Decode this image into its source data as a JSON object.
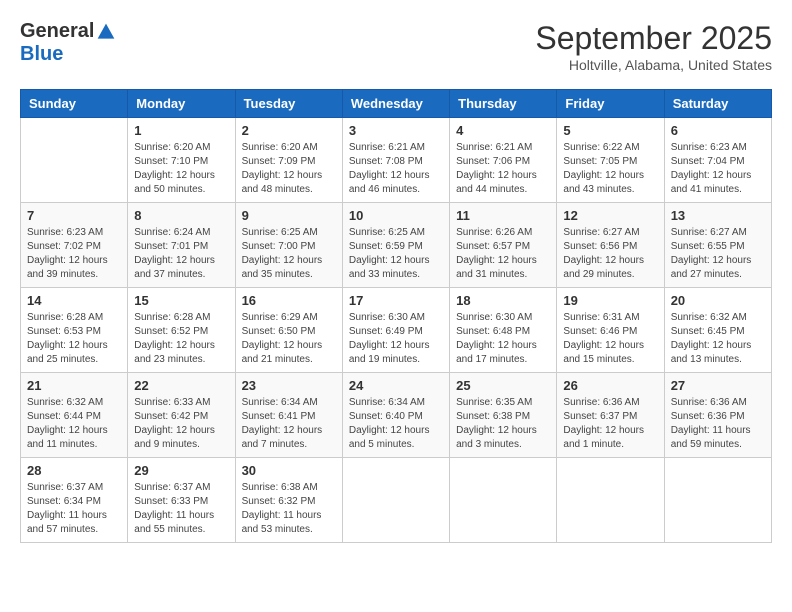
{
  "header": {
    "logo_general": "General",
    "logo_blue": "Blue",
    "month_title": "September 2025",
    "location": "Holtville, Alabama, United States"
  },
  "weekdays": [
    "Sunday",
    "Monday",
    "Tuesday",
    "Wednesday",
    "Thursday",
    "Friday",
    "Saturday"
  ],
  "weeks": [
    [
      {
        "day": "",
        "info": ""
      },
      {
        "day": "1",
        "info": "Sunrise: 6:20 AM\nSunset: 7:10 PM\nDaylight: 12 hours\nand 50 minutes."
      },
      {
        "day": "2",
        "info": "Sunrise: 6:20 AM\nSunset: 7:09 PM\nDaylight: 12 hours\nand 48 minutes."
      },
      {
        "day": "3",
        "info": "Sunrise: 6:21 AM\nSunset: 7:08 PM\nDaylight: 12 hours\nand 46 minutes."
      },
      {
        "day": "4",
        "info": "Sunrise: 6:21 AM\nSunset: 7:06 PM\nDaylight: 12 hours\nand 44 minutes."
      },
      {
        "day": "5",
        "info": "Sunrise: 6:22 AM\nSunset: 7:05 PM\nDaylight: 12 hours\nand 43 minutes."
      },
      {
        "day": "6",
        "info": "Sunrise: 6:23 AM\nSunset: 7:04 PM\nDaylight: 12 hours\nand 41 minutes."
      }
    ],
    [
      {
        "day": "7",
        "info": "Sunrise: 6:23 AM\nSunset: 7:02 PM\nDaylight: 12 hours\nand 39 minutes."
      },
      {
        "day": "8",
        "info": "Sunrise: 6:24 AM\nSunset: 7:01 PM\nDaylight: 12 hours\nand 37 minutes."
      },
      {
        "day": "9",
        "info": "Sunrise: 6:25 AM\nSunset: 7:00 PM\nDaylight: 12 hours\nand 35 minutes."
      },
      {
        "day": "10",
        "info": "Sunrise: 6:25 AM\nSunset: 6:59 PM\nDaylight: 12 hours\nand 33 minutes."
      },
      {
        "day": "11",
        "info": "Sunrise: 6:26 AM\nSunset: 6:57 PM\nDaylight: 12 hours\nand 31 minutes."
      },
      {
        "day": "12",
        "info": "Sunrise: 6:27 AM\nSunset: 6:56 PM\nDaylight: 12 hours\nand 29 minutes."
      },
      {
        "day": "13",
        "info": "Sunrise: 6:27 AM\nSunset: 6:55 PM\nDaylight: 12 hours\nand 27 minutes."
      }
    ],
    [
      {
        "day": "14",
        "info": "Sunrise: 6:28 AM\nSunset: 6:53 PM\nDaylight: 12 hours\nand 25 minutes."
      },
      {
        "day": "15",
        "info": "Sunrise: 6:28 AM\nSunset: 6:52 PM\nDaylight: 12 hours\nand 23 minutes."
      },
      {
        "day": "16",
        "info": "Sunrise: 6:29 AM\nSunset: 6:50 PM\nDaylight: 12 hours\nand 21 minutes."
      },
      {
        "day": "17",
        "info": "Sunrise: 6:30 AM\nSunset: 6:49 PM\nDaylight: 12 hours\nand 19 minutes."
      },
      {
        "day": "18",
        "info": "Sunrise: 6:30 AM\nSunset: 6:48 PM\nDaylight: 12 hours\nand 17 minutes."
      },
      {
        "day": "19",
        "info": "Sunrise: 6:31 AM\nSunset: 6:46 PM\nDaylight: 12 hours\nand 15 minutes."
      },
      {
        "day": "20",
        "info": "Sunrise: 6:32 AM\nSunset: 6:45 PM\nDaylight: 12 hours\nand 13 minutes."
      }
    ],
    [
      {
        "day": "21",
        "info": "Sunrise: 6:32 AM\nSunset: 6:44 PM\nDaylight: 12 hours\nand 11 minutes."
      },
      {
        "day": "22",
        "info": "Sunrise: 6:33 AM\nSunset: 6:42 PM\nDaylight: 12 hours\nand 9 minutes."
      },
      {
        "day": "23",
        "info": "Sunrise: 6:34 AM\nSunset: 6:41 PM\nDaylight: 12 hours\nand 7 minutes."
      },
      {
        "day": "24",
        "info": "Sunrise: 6:34 AM\nSunset: 6:40 PM\nDaylight: 12 hours\nand 5 minutes."
      },
      {
        "day": "25",
        "info": "Sunrise: 6:35 AM\nSunset: 6:38 PM\nDaylight: 12 hours\nand 3 minutes."
      },
      {
        "day": "26",
        "info": "Sunrise: 6:36 AM\nSunset: 6:37 PM\nDaylight: 12 hours\nand 1 minute."
      },
      {
        "day": "27",
        "info": "Sunrise: 6:36 AM\nSunset: 6:36 PM\nDaylight: 11 hours\nand 59 minutes."
      }
    ],
    [
      {
        "day": "28",
        "info": "Sunrise: 6:37 AM\nSunset: 6:34 PM\nDaylight: 11 hours\nand 57 minutes."
      },
      {
        "day": "29",
        "info": "Sunrise: 6:37 AM\nSunset: 6:33 PM\nDaylight: 11 hours\nand 55 minutes."
      },
      {
        "day": "30",
        "info": "Sunrise: 6:38 AM\nSunset: 6:32 PM\nDaylight: 11 hours\nand 53 minutes."
      },
      {
        "day": "",
        "info": ""
      },
      {
        "day": "",
        "info": ""
      },
      {
        "day": "",
        "info": ""
      },
      {
        "day": "",
        "info": ""
      }
    ]
  ]
}
